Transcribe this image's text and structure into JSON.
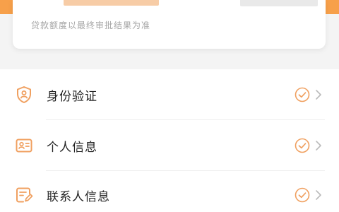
{
  "colors": {
    "accent": "#f7a04a",
    "check": "#f0a060",
    "text": "#222222",
    "muted": "#a6a6a6",
    "chevron": "#bbbbbb"
  },
  "card": {
    "note": "贷款额度以最终审批结果为准"
  },
  "verification_list": {
    "items": [
      {
        "label": "身份验证",
        "icon": "shield-user-icon",
        "status": "completed"
      },
      {
        "label": "个人信息",
        "icon": "id-card-icon",
        "status": "completed"
      },
      {
        "label": "联系人信息",
        "icon": "contact-form-icon",
        "status": "completed"
      }
    ]
  }
}
